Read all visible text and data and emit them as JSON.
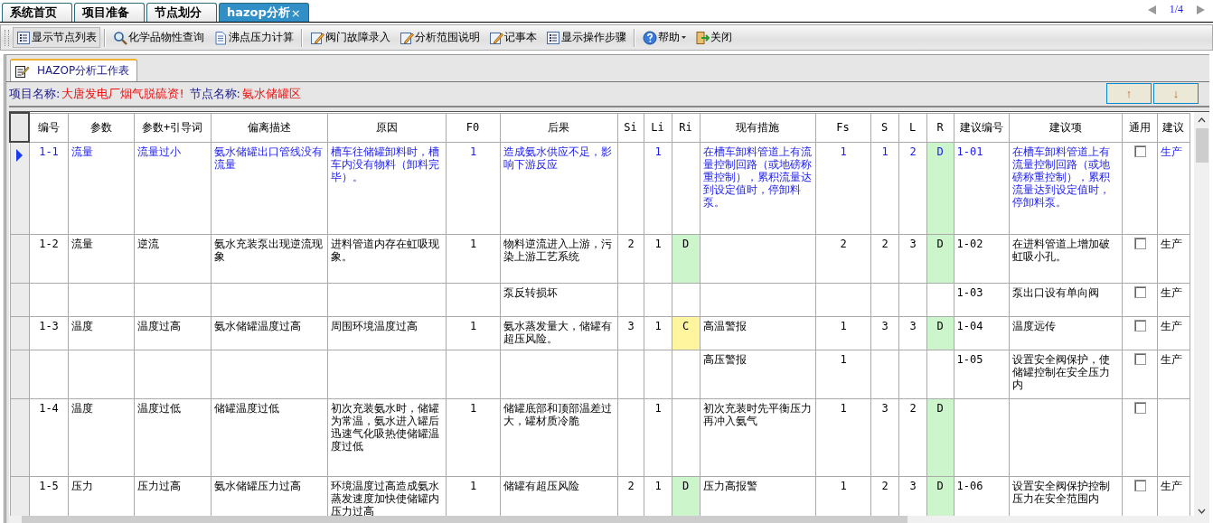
{
  "tabs": [
    {
      "label": "系统首页",
      "selected": false,
      "closable": false
    },
    {
      "label": "项目准备",
      "selected": false,
      "closable": false
    },
    {
      "label": "节点划分",
      "selected": false,
      "closable": false
    },
    {
      "label": "hazop分析",
      "selected": true,
      "closable": true
    }
  ],
  "tab_close": "×",
  "pager": "1/4",
  "toolbar": [
    [
      {
        "label": "显示节点列表",
        "kind": "list",
        "dropdown": false,
        "pressed": true
      }
    ],
    [
      {
        "label": "化学品物性查询",
        "kind": "search",
        "dropdown": false,
        "pressed": false
      },
      {
        "label": "沸点压力计算",
        "kind": "doc",
        "dropdown": false,
        "pressed": false
      }
    ],
    [
      {
        "label": "阀门故障录入",
        "kind": "edit",
        "dropdown": false,
        "pressed": false
      },
      {
        "label": "分析范围说明",
        "kind": "edit",
        "dropdown": false,
        "pressed": false
      },
      {
        "label": "记事本",
        "kind": "edit",
        "dropdown": false,
        "pressed": false
      },
      {
        "label": "显示操作步骤",
        "kind": "list",
        "dropdown": false,
        "pressed": false
      }
    ],
    [
      {
        "label": "帮助",
        "kind": "help",
        "dropdown": true,
        "pressed": false
      },
      {
        "label": "关闭",
        "kind": "exit",
        "dropdown": false,
        "pressed": false
      }
    ]
  ],
  "worksheet_tab": "HAZOP分析工作表",
  "info": [
    {
      "label": "项目名称:",
      "value": "大唐发电厂烟气脱硫资!"
    },
    {
      "label": "节点名称:",
      "value": "氨水储罐区"
    }
  ],
  "move_buttons": [
    {
      "label": "↑"
    },
    {
      "label": "↓"
    }
  ],
  "table": {
    "columns": [
      "编号",
      "参数",
      "参数+引导词",
      "偏离描述",
      "原因",
      "F0",
      "后果",
      "Si",
      "Li",
      "Ri",
      "现有措施",
      "Fs",
      "S",
      "L",
      "R",
      "建议编号",
      "建议项",
      "通用",
      "建议"
    ],
    "rows": [
      {
        "selected": true,
        "general": false,
        "cells": [
          "1-1",
          "流量",
          "流量过小",
          "氨水储罐出口管线没有流量",
          "槽车往储罐卸料时，槽车内没有物料（卸料完毕）。",
          "1",
          "造成氨水供应不足，影响下游反应",
          null,
          "1",
          null,
          "在槽车卸料管道上有流量控制回路（或地磅称重控制），累积流量达到设定值时，停卸料泵。",
          "1",
          "1",
          "2",
          {
            "text": "D",
            "color": "#ccf5cc"
          },
          "1-01",
          "在槽车卸料管道上有流量控制回路（或地磅称重控制），累积流量达到设定值时，停卸料泵。",
          null,
          "生产"
        ]
      },
      {
        "selected": false,
        "general": false,
        "cells": [
          "1-2",
          "流量",
          "逆流",
          "氨水充装泵出现逆流现象",
          "进料管道内存在虹吸现象。",
          "1",
          "物料逆流进入上游，污染上游工艺系统",
          "2",
          "1",
          {
            "text": "D",
            "color": "#ccf5cc"
          },
          null,
          "2",
          "2",
          "3",
          {
            "text": "D",
            "color": "#ccf5cc"
          },
          "1-02",
          "在进料管道上增加破虹吸小孔。",
          null,
          "生产"
        ]
      },
      {
        "selected": false,
        "general": false,
        "cells": [
          null,
          null,
          null,
          null,
          null,
          null,
          "泵反转损坏",
          null,
          null,
          null,
          null,
          null,
          null,
          null,
          null,
          "1-03",
          "泵出口设有单向阀",
          null,
          "生产"
        ]
      },
      {
        "selected": false,
        "general": false,
        "cells": [
          "1-3",
          "温度",
          "温度过高",
          "氨水储罐温度过高",
          "周围环境温度过高",
          "1",
          "氨水蒸发量大，储罐有超压风险。",
          "3",
          "1",
          {
            "text": "C",
            "color": "#fff59e"
          },
          "高温警报",
          "1",
          "3",
          "3",
          {
            "text": "D",
            "color": "#ccf5cc"
          },
          "1-04",
          "温度远传",
          null,
          "生产"
        ]
      },
      {
        "selected": false,
        "general": false,
        "cells": [
          null,
          null,
          null,
          null,
          null,
          null,
          null,
          null,
          null,
          null,
          "高压警报",
          "1",
          null,
          null,
          null,
          "1-05",
          "设置安全阀保护，使储罐控制在安全压力内",
          null,
          "生产"
        ]
      },
      {
        "selected": false,
        "general": false,
        "cells": [
          "1-4",
          "温度",
          "温度过低",
          "储罐温度过低",
          "初次充装氨水时，储罐为常温，氨水进入罐后迅速气化吸热使储罐温度过低",
          "1",
          "储罐底部和顶部温差过大，罐材质冷脆",
          null,
          "1",
          null,
          "初次充装时先平衡压力再冲入氨气",
          "1",
          "3",
          "2",
          {
            "text": "D",
            "color": "#ccf5cc"
          },
          null,
          null,
          null,
          null
        ]
      },
      {
        "selected": false,
        "general": false,
        "cells": [
          "1-5",
          "压力",
          "压力过高",
          "氨水储罐压力过高",
          "环境温度过高造成氨水蒸发速度加快使储罐内压力过高",
          "1",
          "储罐有超压风险",
          "2",
          "1",
          {
            "text": "D",
            "color": "#ccf5cc"
          },
          "压力高报警",
          "1",
          "2",
          "3",
          {
            "text": "D",
            "color": "#ccf5cc"
          },
          "1-06",
          "设置安全阀保护控制压力在安全范围内",
          null,
          "生产"
        ]
      }
    ]
  }
}
